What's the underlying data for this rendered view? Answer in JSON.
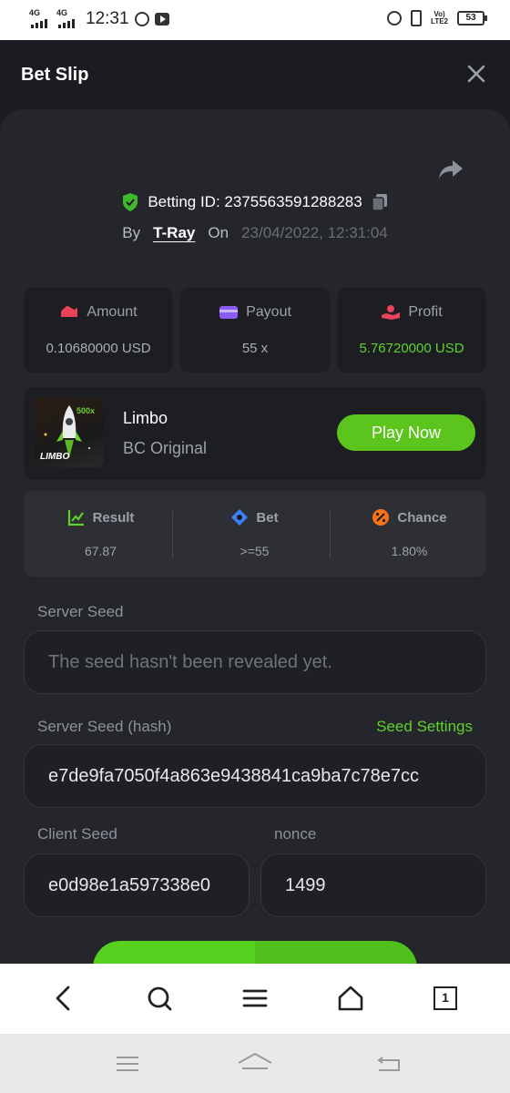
{
  "status_bar": {
    "net1": "4G",
    "net2": "4G",
    "time": "12:31",
    "volte_top": "Vo)",
    "volte_bottom": "LTE2",
    "battery": "53"
  },
  "header": {
    "title": "Bet Slip"
  },
  "bet": {
    "betting_id": "Betting ID: 2375563591288283",
    "by_label": "By",
    "user": "T-Ray",
    "on_label": "On",
    "date": "23/04/2022, 12:31:04"
  },
  "stats": [
    {
      "label": "Amount",
      "value": "0.10680000 USD",
      "icon": "amount-icon",
      "color": "#e8435a"
    },
    {
      "label": "Payout",
      "value": "55 x",
      "icon": "wallet-icon",
      "color": "#8b5cf6"
    },
    {
      "label": "Profit",
      "value": "5.76720000 USD",
      "icon": "profit-hand-icon",
      "color": "#e8435a"
    }
  ],
  "game": {
    "thumb_badge": "500x",
    "thumb_label": "LIMBO",
    "name": "Limbo",
    "subtitle": "BC Original",
    "play_label": "Play Now"
  },
  "result": [
    {
      "label": "Result",
      "value": "67.87",
      "icon": "result-chart-icon",
      "color": "#5ed22a"
    },
    {
      "label": "Bet",
      "value": ">=55",
      "icon": "bet-ticket-icon",
      "color": "#3b82f6"
    },
    {
      "label": "Chance",
      "value": "1.80%",
      "icon": "percent-icon",
      "color": "#f97316"
    }
  ],
  "seeds": {
    "server_seed_label": "Server Seed",
    "server_seed_placeholder": "The seed hasn't been revealed yet.",
    "server_hash_label": "Server Seed (hash)",
    "seed_settings": "Seed Settings",
    "server_hash": "e7de9fa7050f4a863e9438841ca9ba7c78e7cc",
    "client_seed_label": "Client Seed",
    "client_seed": "e0d98e1a597338e0",
    "nonce_label": "nonce",
    "nonce": "1499"
  },
  "browser_nav": {
    "tab_count": "1"
  }
}
